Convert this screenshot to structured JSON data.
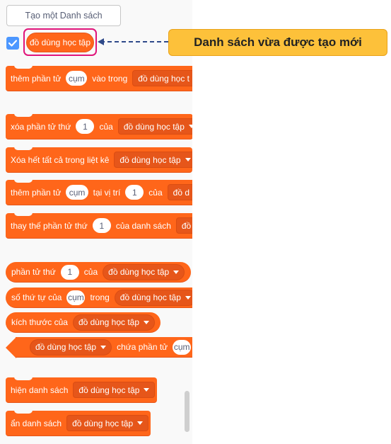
{
  "palette": {
    "make_list_button": "Tạo một Danh sách",
    "list_variable": {
      "checked": true,
      "name": "đồ dùng học tập"
    },
    "blocks": {
      "add_item": {
        "text1": "thêm phần tử",
        "input": "cụm",
        "text2": "vào trong",
        "dropdown": "đồ dùng học t"
      },
      "delete_item": {
        "text1": "xóa phần tử thứ",
        "input": "1",
        "text2": "của",
        "dropdown": "đồ dùng học tập"
      },
      "delete_all": {
        "text1": "Xóa hết tất cả trong liệt kê",
        "dropdown": "đồ dùng học tập"
      },
      "insert_item": {
        "text1": "thêm phần tử",
        "input1": "cụm",
        "text2": "tại vị trí",
        "input2": "1",
        "text3": "của",
        "dropdown": "đồ d"
      },
      "replace_item": {
        "text1": "thay thế phần tử thứ",
        "input": "1",
        "text2": "của danh sách",
        "dropdown": "đồ"
      },
      "item_of": {
        "text1": "phần tử thứ",
        "input": "1",
        "text2": "của",
        "dropdown": "đồ dùng học tập"
      },
      "item_index": {
        "text1": "số thứ tự của",
        "input": "cụm",
        "text2": "trong",
        "dropdown": "đồ dùng học tập"
      },
      "length": {
        "text1": "kích thước của",
        "dropdown": "đồ dùng học tập"
      },
      "contains": {
        "dropdown": "đồ dùng học tập",
        "text1": "chứa phần tử",
        "input": "cụm",
        "text2": "?"
      },
      "show_list": {
        "text1": "hiện danh sách",
        "dropdown": "đồ dùng học tập"
      },
      "hide_list": {
        "text1": "ẩn danh sách",
        "dropdown": "đồ dùng học tập"
      }
    }
  },
  "annotation": {
    "label": "Danh sách vừa được tạo mới"
  },
  "colors": {
    "list_block": "#ff661a",
    "highlight_border": "#e0147a",
    "callout_bg": "#fdc13a",
    "arrow": "#2f4a8a",
    "checkbox": "#4c97ff"
  }
}
